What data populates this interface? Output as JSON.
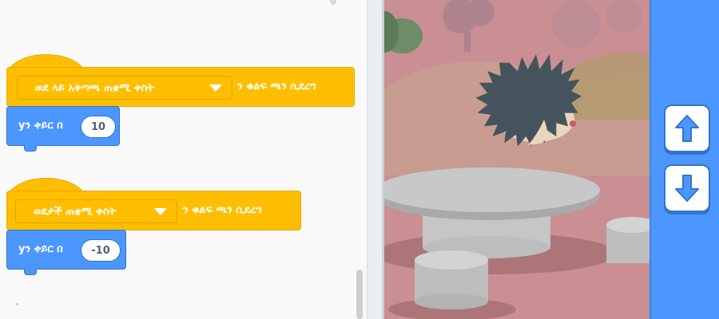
{
  "code_area": {
    "script1": {
      "dropdown_value": "ወደ ላይ አቅጣጫ ጠቋሚ ቀስት",
      "hat_suffix": "ን ቁልፍ ጫን ሲደረግ",
      "motion_label": "yን ቀይር በ",
      "motion_value": "10"
    },
    "script2": {
      "dropdown_value": "ወደታች ጠቋሚ ቀስት",
      "hat_suffix": "ን ቁልፍ ጫን ሲደረግ",
      "motion_label": "yን ቀይር በ",
      "motion_value": "-10"
    }
  },
  "colors": {
    "events": "#ffbf00",
    "motion": "#4c97ff",
    "stage_bg": "#c98f92"
  },
  "controls": {
    "up_icon": "arrow-up-icon",
    "down_icon": "arrow-down-icon"
  }
}
